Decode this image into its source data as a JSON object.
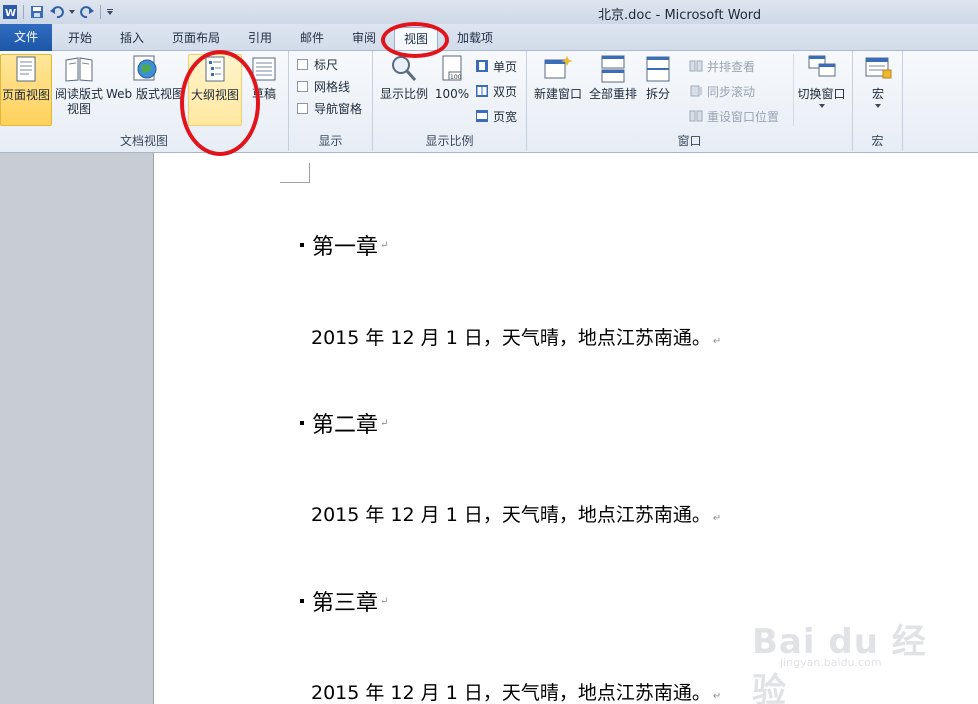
{
  "window": {
    "title": "北京.doc - Microsoft Word"
  },
  "tabs": [
    {
      "label": "文件"
    },
    {
      "label": "开始"
    },
    {
      "label": "插入"
    },
    {
      "label": "页面布局"
    },
    {
      "label": "引用"
    },
    {
      "label": "邮件"
    },
    {
      "label": "审阅"
    },
    {
      "label": "视图"
    },
    {
      "label": "加载项"
    }
  ],
  "ribbon": {
    "doc_views": {
      "label": "文档视图",
      "print_layout": "页面视图",
      "full_screen_reading": "阅读版式视图",
      "web_layout": "Web 版式视图",
      "outline": "大纲视图",
      "draft": "草稿"
    },
    "show": {
      "label": "显示",
      "ruler": "标尺",
      "gridlines": "网格线",
      "nav_pane": "导航窗格"
    },
    "zoom": {
      "label": "显示比例",
      "zoom": "显示比例",
      "hundred": "100%",
      "one_page": "单页",
      "two_pages": "双页",
      "page_width": "页宽"
    },
    "window": {
      "label": "窗口",
      "new_window": "新建窗口",
      "arrange_all": "全部重排",
      "split": "拆分",
      "side_by_side": "并排查看",
      "sync_scroll": "同步滚动",
      "reset_position": "重设窗口位置",
      "switch_windows": "切换窗口"
    },
    "macros": {
      "label": "宏",
      "macros": "宏"
    }
  },
  "document": {
    "blocks": [
      {
        "heading": "第一章",
        "para": "2015 年 12 月 1 日，天气晴，地点江苏南通。"
      },
      {
        "heading": "第二章",
        "para": "2015 年 12 月 1 日，天气晴，地点江苏南通。"
      },
      {
        "heading": "第三章",
        "para": "2015 年 12 月 1 日，天气晴，地点江苏南通。"
      }
    ],
    "para_mark": "↵"
  },
  "watermark": {
    "text": "Bai du 经验",
    "url": "jingyan.baidu.com"
  },
  "colors": {
    "file_tab": "#1d56a8",
    "selected": "#ffd15c",
    "annotation": "#e1141c"
  }
}
